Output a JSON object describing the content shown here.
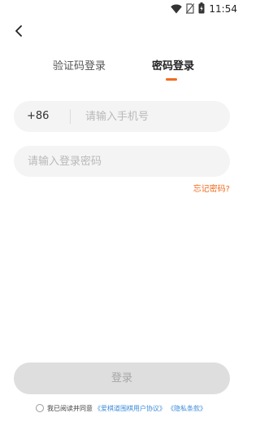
{
  "status_bar": {
    "time": "11:54",
    "icons": [
      "wifi-icon",
      "no-sim-icon",
      "battery-charging-icon"
    ]
  },
  "nav": {
    "back_icon": "chevron-left-icon"
  },
  "tabs": [
    {
      "label": "验证码登录",
      "active": false
    },
    {
      "label": "密码登录",
      "active": true
    }
  ],
  "phone": {
    "country_code": "+86",
    "placeholder": "请输入手机号",
    "value": ""
  },
  "password": {
    "placeholder": "请输入登录密码",
    "value": ""
  },
  "forgot_password": "忘记密码?",
  "login_button": "登录",
  "agreement": {
    "checked": false,
    "text": "我已阅读并同意",
    "user_agreement": "《爱棋道围棋用户协议》",
    "privacy_policy": "《隐私条款》"
  },
  "colors": {
    "accent": "#f26b1d",
    "link": "#3d8bd9",
    "button_disabled_bg": "#dedede",
    "input_bg": "#f4f4f4"
  }
}
